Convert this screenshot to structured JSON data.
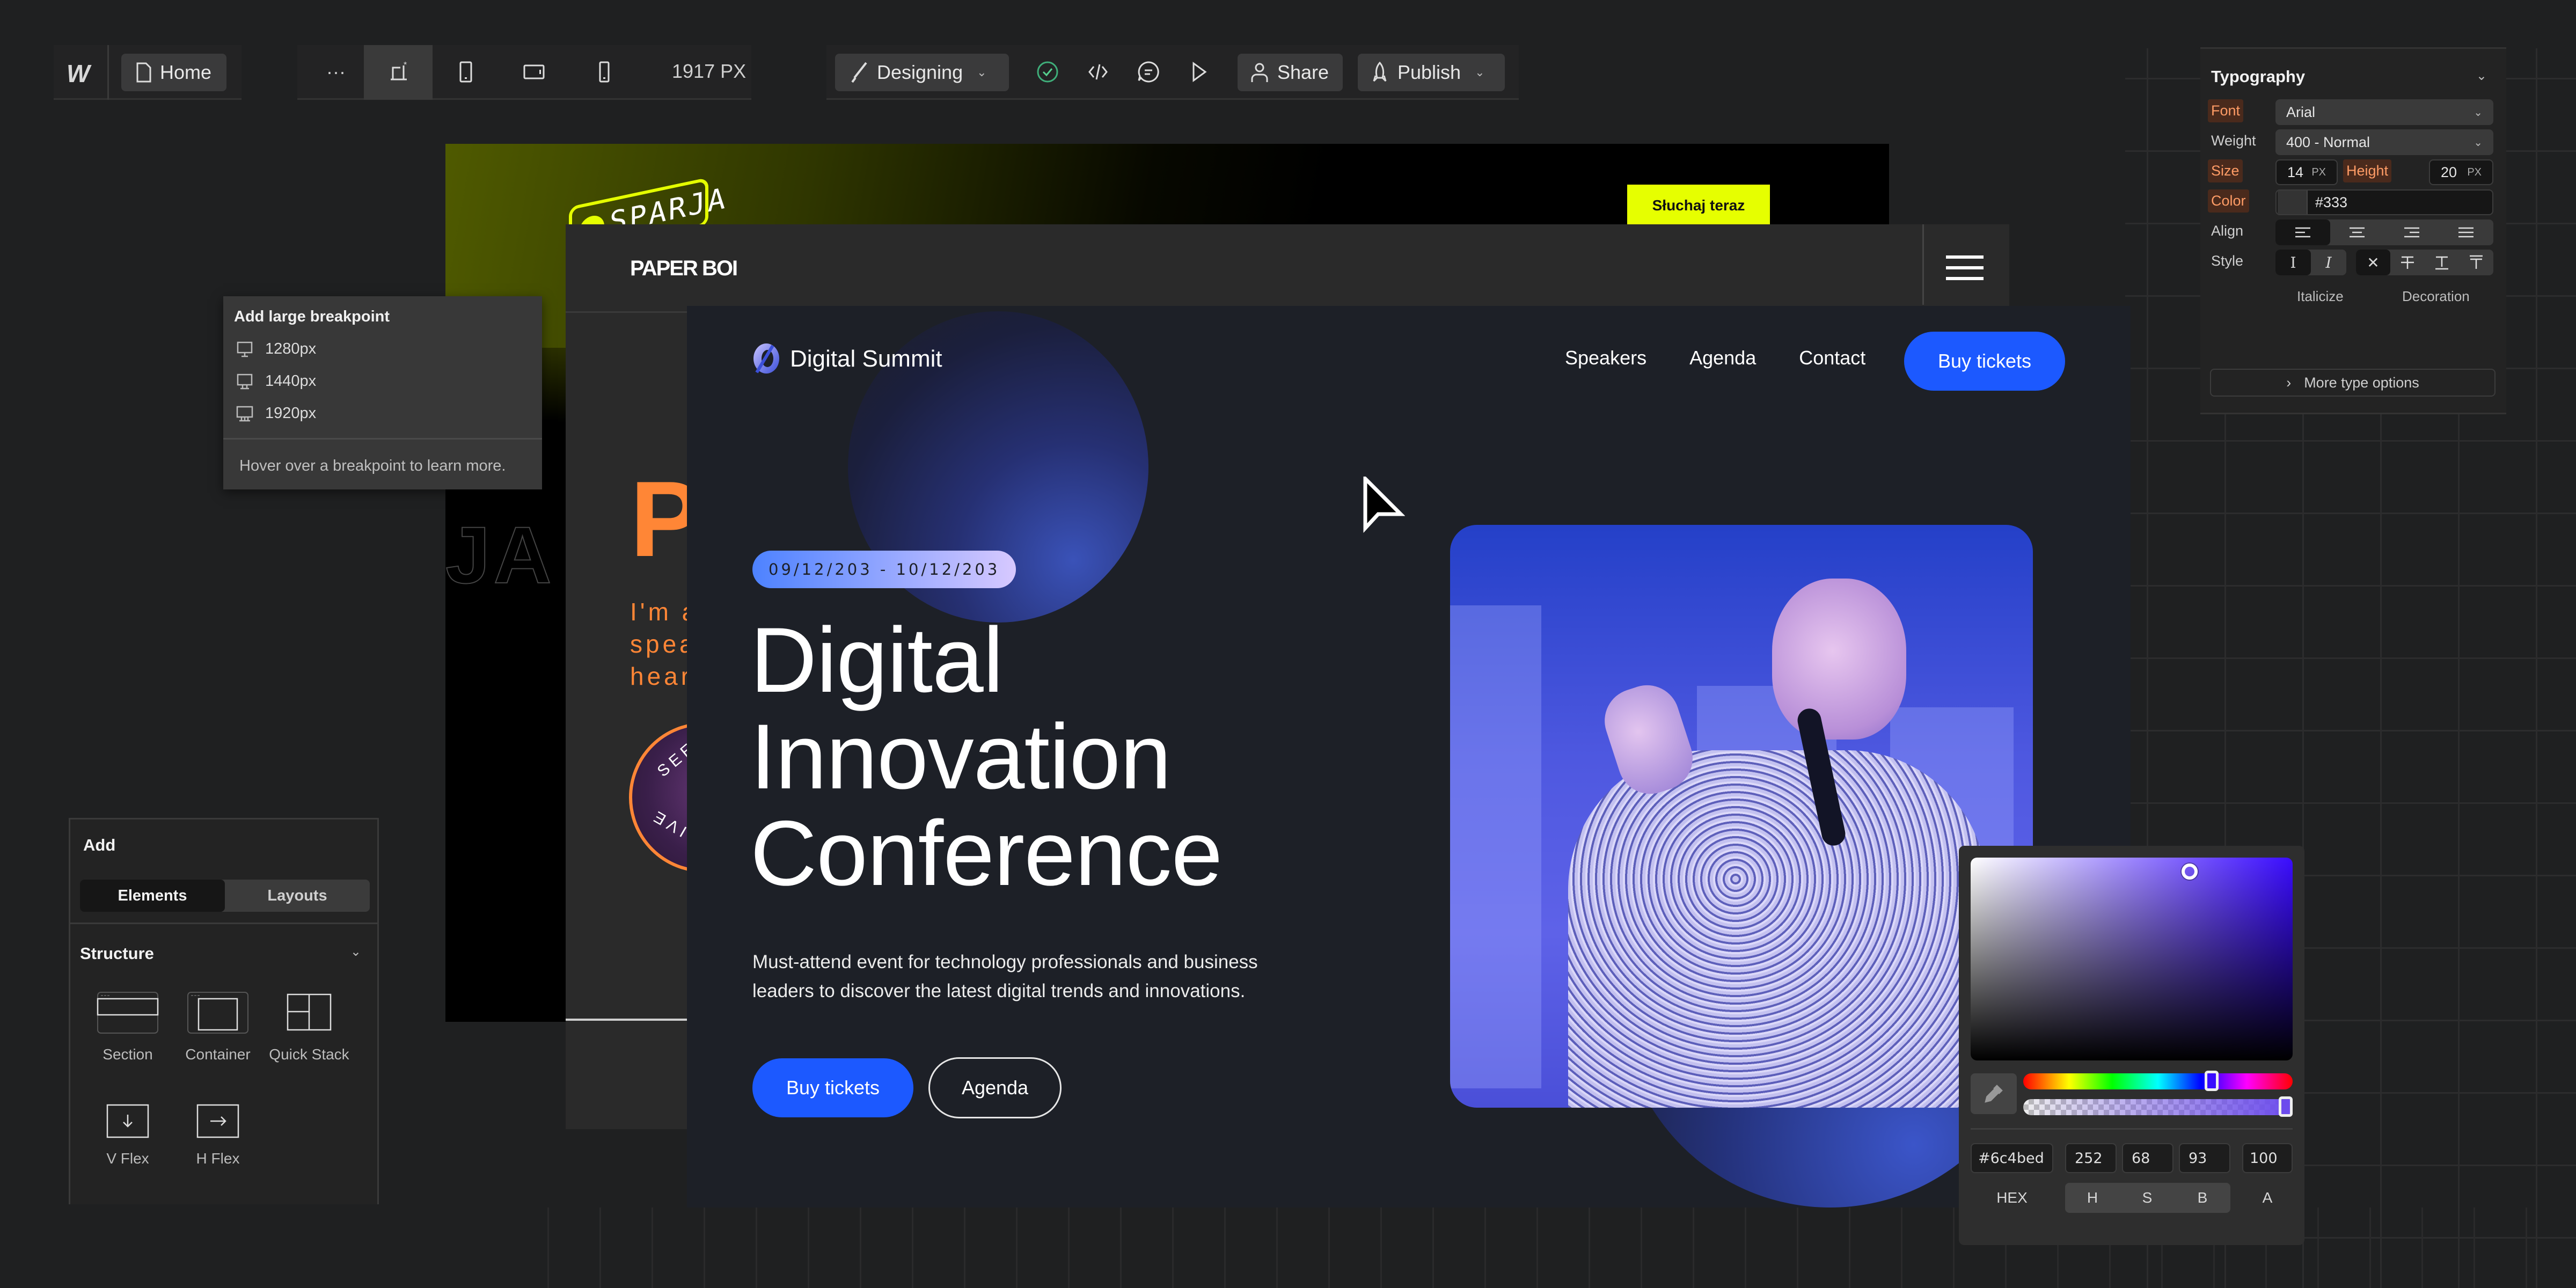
{
  "toolbar": {
    "logo": "W",
    "page_label": "Home",
    "more_label": "···",
    "viewport_width": "1917 PX",
    "mode_label": "Designing",
    "share_label": "Share",
    "publish_label": "Publish"
  },
  "breakpoint_popover": {
    "title": "Add large breakpoint",
    "items": [
      {
        "label": "1280px"
      },
      {
        "label": "1440px"
      },
      {
        "label": "1920px"
      }
    ],
    "hint": "Hover over a breakpoint to learn more."
  },
  "add_panel": {
    "title": "Add",
    "tabs": [
      {
        "label": "Elements",
        "active": true
      },
      {
        "label": "Layouts",
        "active": false
      }
    ],
    "section_title": "Structure",
    "elements": [
      {
        "label": "Section"
      },
      {
        "label": "Container"
      },
      {
        "label": "Quick Stack"
      },
      {
        "label": "V Flex"
      },
      {
        "label": "H Flex"
      }
    ]
  },
  "site_green": {
    "logo_text": "SPARJA",
    "cta_label": "Słuchaj teraz",
    "outline_text": "JA"
  },
  "site_paper": {
    "logo": "PAPER BOI",
    "headline_fragment": "P",
    "sub_lines": [
      "I'm a",
      "spea",
      "heard"
    ],
    "badge_top": "SEE M",
    "badge_bottom": "LIVE"
  },
  "site_ds": {
    "brand": "Digital Summit",
    "nav": [
      {
        "label": "Speakers"
      },
      {
        "label": "Agenda"
      },
      {
        "label": "Contact"
      }
    ],
    "nav_cta": "Buy tickets",
    "date_range": "09/12/203 - 10/12/203",
    "title_lines": [
      "Digital",
      "Innovation",
      "Conference"
    ],
    "description": "Must-attend event for technology professionals and business leaders to discover the latest digital trends and innovations.",
    "primary_cta": "Buy tickets",
    "secondary_cta": "Agenda",
    "accent_color": "#1c59ff"
  },
  "typography": {
    "title": "Typography",
    "font_label": "Font",
    "font_value": "Arial",
    "weight_label": "Weight",
    "weight_value": "400 - Normal",
    "size_label": "Size",
    "size_value": "14",
    "size_unit": "PX",
    "height_label": "Height",
    "height_value": "20",
    "height_unit": "PX",
    "color_label": "Color",
    "color_value": "#333",
    "align_label": "Align",
    "style_label": "Style",
    "italicize_label": "Italicize",
    "decoration_label": "Decoration",
    "more_label": "More type options"
  },
  "color_picker": {
    "hex": "#6c4bed",
    "h": "252",
    "s": "68",
    "b": "93",
    "a": "100",
    "mode_labels": {
      "hex": "HEX",
      "h": "H",
      "s": "S",
      "b": "B",
      "a": "A"
    },
    "hue_fraction": 0.7,
    "alpha_fraction": 1.0,
    "saturation_fraction": 0.68,
    "brightness_fraction": 0.93
  }
}
